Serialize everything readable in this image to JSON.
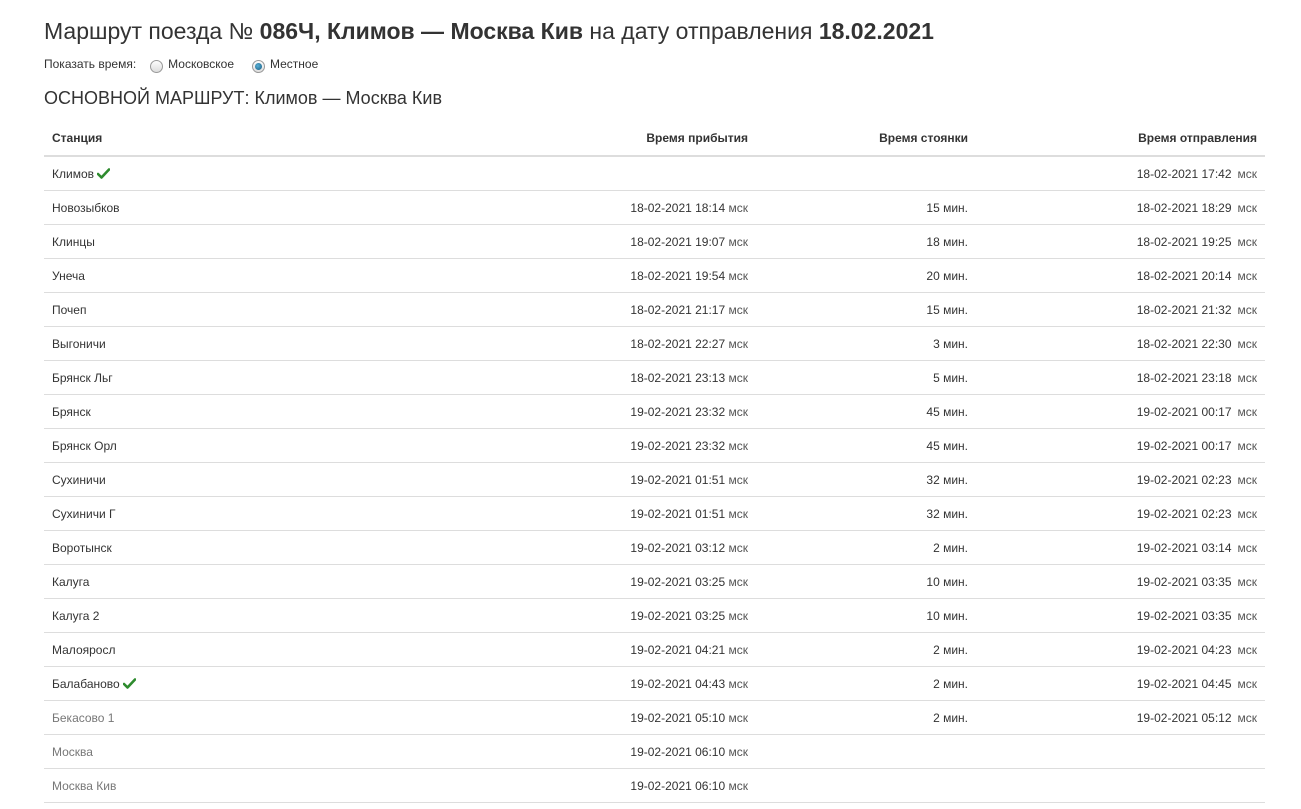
{
  "header": {
    "title_prefix": "Маршрут поезда №",
    "train_number": "086Ч,",
    "route": "Климов — Москва Кив",
    "date_prefix": "на дату отправления",
    "date": "18.02.2021"
  },
  "time_mode": {
    "label": "Показать время:",
    "options": [
      {
        "label": "Московское",
        "checked": false
      },
      {
        "label": "Местное",
        "checked": true
      }
    ]
  },
  "section_title": "ОСНОВНОЙ МАРШРУТ: Климов — Москва Кив",
  "table": {
    "columns": [
      "Станция",
      "Время прибытия",
      "Время стоянки",
      "Время отправления"
    ],
    "unit": "мск",
    "rows": [
      {
        "station": "Климов",
        "checked": true,
        "arrival": "",
        "stop": "",
        "departure": "18-02-2021 17:42"
      },
      {
        "station": "Новозыбков",
        "arrival": "18-02-2021 18:14",
        "stop": "15 мин.",
        "departure": "18-02-2021 18:29"
      },
      {
        "station": "Клинцы",
        "arrival": "18-02-2021 19:07",
        "stop": "18 мин.",
        "departure": "18-02-2021 19:25"
      },
      {
        "station": "Унеча",
        "arrival": "18-02-2021 19:54",
        "stop": "20 мин.",
        "departure": "18-02-2021 20:14"
      },
      {
        "station": "Почеп",
        "arrival": "18-02-2021 21:17",
        "stop": "15 мин.",
        "departure": "18-02-2021 21:32"
      },
      {
        "station": "Выгоничи",
        "arrival": "18-02-2021 22:27",
        "stop": "3 мин.",
        "departure": "18-02-2021 22:30"
      },
      {
        "station": "Брянск Льг",
        "arrival": "18-02-2021 23:13",
        "stop": "5 мин.",
        "departure": "18-02-2021 23:18"
      },
      {
        "station": "Брянск",
        "arrival": "19-02-2021 23:32",
        "stop": "45 мин.",
        "departure": "19-02-2021 00:17"
      },
      {
        "station": "Брянск Орл",
        "arrival": "19-02-2021 23:32",
        "stop": "45 мин.",
        "departure": "19-02-2021 00:17"
      },
      {
        "station": "Сухиничи",
        "arrival": "19-02-2021 01:51",
        "stop": "32 мин.",
        "departure": "19-02-2021 02:23"
      },
      {
        "station": "Сухиничи Г",
        "arrival": "19-02-2021 01:51",
        "stop": "32 мин.",
        "departure": "19-02-2021 02:23"
      },
      {
        "station": "Воротынск",
        "arrival": "19-02-2021 03:12",
        "stop": "2 мин.",
        "departure": "19-02-2021 03:14"
      },
      {
        "station": "Калуга",
        "arrival": "19-02-2021 03:25",
        "stop": "10 мин.",
        "departure": "19-02-2021 03:35"
      },
      {
        "station": "Калуга 2",
        "arrival": "19-02-2021 03:25",
        "stop": "10 мин.",
        "departure": "19-02-2021 03:35"
      },
      {
        "station": "Малояросл",
        "arrival": "19-02-2021 04:21",
        "stop": "2 мин.",
        "departure": "19-02-2021 04:23"
      },
      {
        "station": "Балабаново",
        "checked": true,
        "arrival": "19-02-2021 04:43",
        "stop": "2 мин.",
        "departure": "19-02-2021 04:45"
      },
      {
        "station": "Бекасово 1",
        "muted": true,
        "arrival": "19-02-2021 05:10",
        "stop": "2 мин.",
        "departure": "19-02-2021 05:12"
      },
      {
        "station": "Москва",
        "muted": true,
        "arrival": "19-02-2021 06:10",
        "stop": "",
        "departure": ""
      },
      {
        "station": "Москва Кив",
        "muted": true,
        "arrival": "19-02-2021 06:10",
        "stop": "",
        "departure": ""
      }
    ]
  },
  "colors": {
    "text": "#333333",
    "muted_text": "#777777",
    "check_green": "#2e8b2e",
    "border": "#dddddd"
  }
}
